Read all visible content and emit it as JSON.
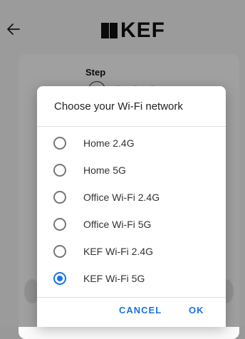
{
  "app": {
    "brand": "KEF",
    "step_label": "Step"
  },
  "dialog": {
    "title": "Choose your Wi-Fi network",
    "options": [
      {
        "label": "Home 2.4G",
        "selected": false
      },
      {
        "label": "Home 5G",
        "selected": false
      },
      {
        "label": "Office Wi-Fi 2.4G",
        "selected": false
      },
      {
        "label": "Office Wi-Fi 5G",
        "selected": false
      },
      {
        "label": "KEF Wi-Fi 2.4G",
        "selected": false
      },
      {
        "label": "KEF Wi-Fi 5G",
        "selected": true
      }
    ],
    "cancel_label": "CANCEL",
    "ok_label": "OK"
  },
  "colors": {
    "accent": "#1a73e8",
    "scrim": "rgba(0,0,0,0.36)"
  },
  "icons": {
    "back": "arrow-left-icon",
    "logo": "kef-logo"
  }
}
